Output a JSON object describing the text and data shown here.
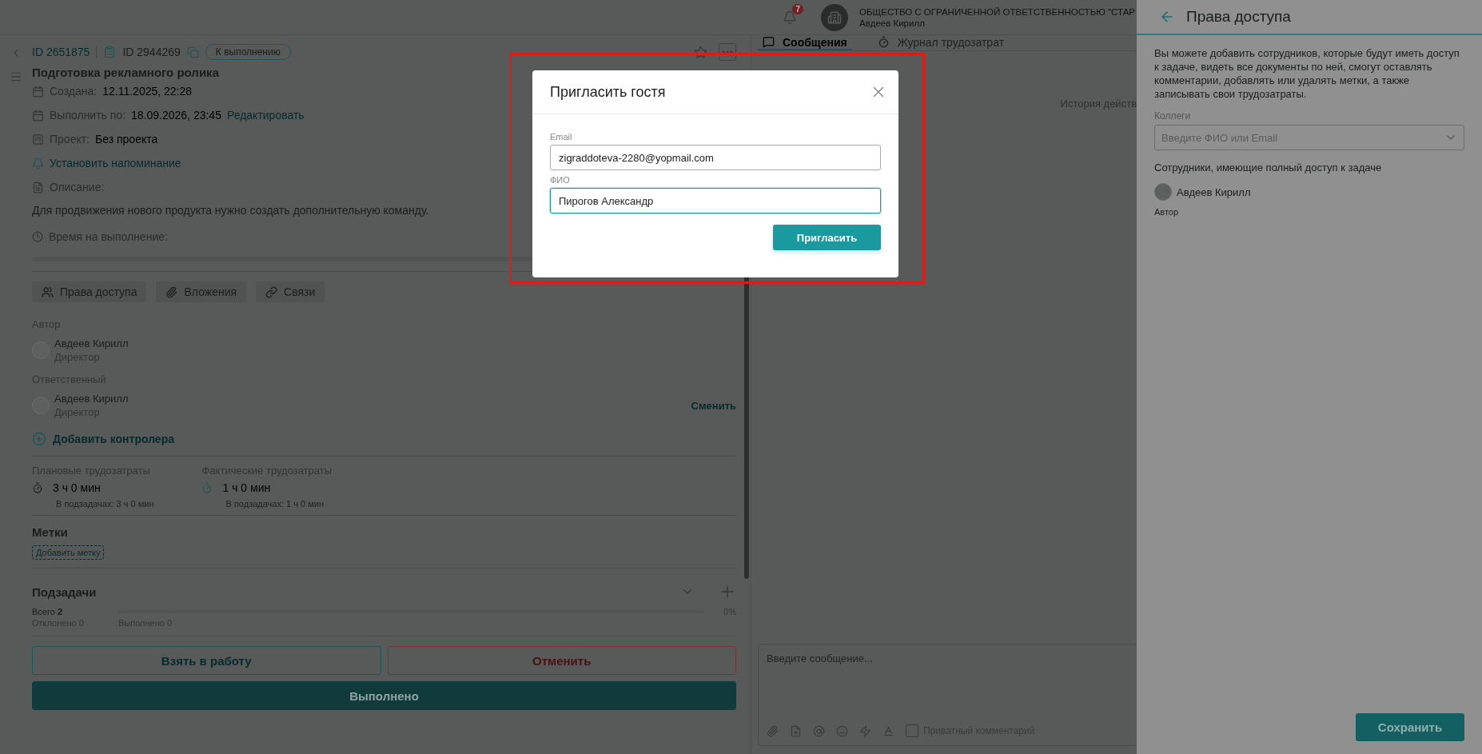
{
  "header": {
    "notifications": "7",
    "organization": "ОБЩЕСТВО С ОГРАНИЧЕННОЙ ОТВЕТСТВЕННОСТЬЮ \"СТАР",
    "user": "Авдеев Кирилл"
  },
  "task": {
    "id": "ID 2651875",
    "parent_id": "ID 2944269",
    "status": "К выполнению",
    "title": "Подготовка рекламного ролика",
    "fields": [
      {
        "kind": "date",
        "label": "Создана:",
        "value": "12.11.2025, 22:28"
      },
      {
        "kind": "date",
        "label": "Выполнить по:",
        "value": "18.09.2026, 23:45",
        "link": "Редактировать"
      },
      {
        "kind": "project",
        "label": "Проект:",
        "value": "Без проекта"
      },
      {
        "kind": "reminder",
        "link": "Установить напоминание"
      },
      {
        "kind": "description",
        "label": "Описание:"
      }
    ],
    "description": "Для продвижения нового продукта нужно создать дополнительную команду.",
    "time_label": "Время на выполнение:",
    "tabs": [
      {
        "kind": "access",
        "label": "Права доступа"
      },
      {
        "kind": "attachments",
        "label": "Вложения"
      },
      {
        "kind": "links",
        "label": "Связи"
      }
    ],
    "people": [
      {
        "label": "Автор",
        "name": "Авдеев Кирилл",
        "role": "Директор"
      },
      {
        "label": "Ответственный",
        "name": "Авдеев Кирилл",
        "role": "Директор",
        "action": "Сменить"
      }
    ],
    "add_controller": "Добавить контролера",
    "effort": [
      {
        "kind": "planned",
        "label": "Плановые трудозатраты",
        "value": "3 ч 0 мин",
        "sub": "В подзадачах: 3 ч 0 мин"
      },
      {
        "kind": "actual",
        "label": "Фактические трудозатраты",
        "value": "1 ч 0 мин",
        "sub": "В подзадачах: 1 ч 0 мин"
      }
    ],
    "tags": {
      "title": "Метки",
      "add": "Добавить метку"
    },
    "subtasks": {
      "title": "Подзадачи",
      "total_label": "Всего",
      "total": "2",
      "rejected": "Отклонено 0",
      "done": "Выполнено 0",
      "percent": "0%",
      "level": 0
    },
    "actions": [
      {
        "kind": "outline",
        "label": "Взять в работу"
      },
      {
        "kind": "danger",
        "label": "Отменить"
      },
      {
        "kind": "primary",
        "label": "Выполнено"
      }
    ]
  },
  "feed": {
    "tabs": [
      {
        "kind": "messages",
        "label": "Сообщения",
        "selected": true
      },
      {
        "kind": "effort",
        "label": "Журнал трудозатрат",
        "selected": false
      }
    ],
    "history": "История действ",
    "composer": {
      "placeholder": "Введите сообщение...",
      "private": {
        "label": "Приватный комментарий",
        "checked": false
      }
    }
  },
  "drawer": {
    "title": "Права доступа",
    "intro": "Вы можете добавить сотрудников, которые будут иметь доступ к задаче, видеть все документы по ней, смогут оставлять комментарии, добавлять или удалять метки, а также записывать свои трудозатраты.",
    "colleagues": {
      "label": "Коллеги",
      "placeholder": "Введите ФИО или Email"
    },
    "members_title": "Сотрудники, имеющие полный доступ к задаче",
    "members": [
      {
        "name": "Авдеев Кирилл",
        "role": "Автор"
      }
    ],
    "save": "Сохранить"
  },
  "dialog": {
    "title": "Пригласить гостя",
    "fields": [
      {
        "label": "Email",
        "value": "zigraddoteva-2280@yopmail.com",
        "focused": false
      },
      {
        "label": "ФИО",
        "value": "Пирогов Александр",
        "focused": true
      }
    ],
    "submit": "Пригласить"
  }
}
